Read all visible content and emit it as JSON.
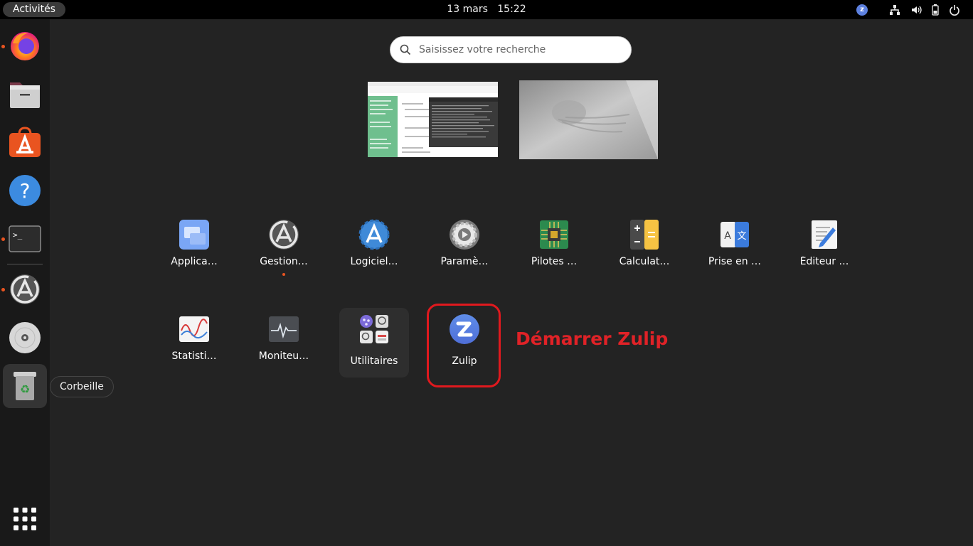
{
  "topbar": {
    "activities_label": "Activités",
    "date": "13 mars",
    "time": "15:22",
    "tray_icons": [
      "zulip-icon",
      "network-icon",
      "volume-icon",
      "battery-icon",
      "power-icon"
    ]
  },
  "dock": {
    "items": [
      {
        "name": "firefox",
        "running": true
      },
      {
        "name": "files",
        "running": false
      },
      {
        "name": "ubuntu-software",
        "running": false
      },
      {
        "name": "help",
        "running": false
      },
      {
        "name": "terminal",
        "running": true
      },
      {
        "name": "software-updater",
        "running": true
      },
      {
        "name": "disc",
        "running": false
      },
      {
        "name": "trash",
        "running": false
      }
    ],
    "tooltip": "Corbeille"
  },
  "search": {
    "placeholder": "Saisissez votre recherche"
  },
  "apps": {
    "row1": [
      {
        "label": "Applica…",
        "icon": "applications-icon"
      },
      {
        "label": "Gestion…",
        "icon": "update-manager-icon"
      },
      {
        "label": "Logiciel…",
        "icon": "software-properties-icon"
      },
      {
        "label": "Paramè…",
        "icon": "settings-icon"
      },
      {
        "label": "Pilotes …",
        "icon": "drivers-icon"
      },
      {
        "label": "Calculat…",
        "icon": "calculator-icon"
      },
      {
        "label": "Prise en …",
        "icon": "language-support-icon"
      },
      {
        "label": "Éditeur …",
        "icon": "text-editor-icon"
      }
    ],
    "row2": [
      {
        "label": "Statisti…",
        "icon": "power-statistics-icon"
      },
      {
        "label": "Moniteu…",
        "icon": "system-monitor-icon"
      },
      {
        "label": "Utilitaires",
        "icon": "folder-icon"
      },
      {
        "label": "Zulip",
        "icon": "zulip-icon"
      }
    ]
  },
  "annotation": {
    "text": "Démarrer Zulip",
    "color": "#e02227"
  },
  "colors": {
    "accent": "#e95420",
    "background": "#232323",
    "dock": "#191919"
  }
}
